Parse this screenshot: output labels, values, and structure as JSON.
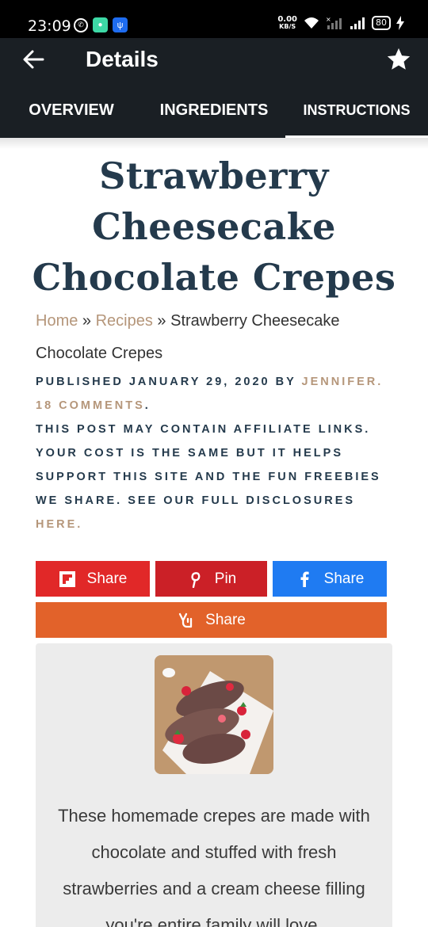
{
  "status_bar": {
    "time": "23:09",
    "speed_value": "0.00",
    "speed_unit": "KB/S",
    "battery": "80"
  },
  "app_bar": {
    "title": "Details",
    "back_icon": "arrow-left-icon",
    "favorite_icon": "star-icon"
  },
  "tabs": [
    {
      "label": "OVERVIEW"
    },
    {
      "label": "INGREDIENTS"
    },
    {
      "label": "INSTRUCTIONS",
      "active": true
    }
  ],
  "article": {
    "title": "Strawberry Cheesecake Chocolate Crepes",
    "breadcrumb": {
      "home": "Home",
      "sep1": " » ",
      "recipes": "Recipes",
      "sep2": " » ",
      "current": "Strawberry Cheesecake Chocolate Crepes"
    },
    "meta": {
      "published": "PUBLISHED JANUARY 29, 2020 BY ",
      "author": "JENNIFER",
      "sep": ". ",
      "comments": "18 COMMENTS",
      "end": ".",
      "disclosure": "THIS POST MAY CONTAIN AFFILIATE LINKS. YOUR COST IS THE SAME BUT IT HELPS SUPPORT THIS SITE AND THE FUN FREEBIES WE SHARE. SEE OUR FULL DISCLOSURES ",
      "here": "HERE",
      "here_end": "."
    }
  },
  "share": {
    "flipboard": "Share",
    "pinterest": "Pin",
    "facebook": "Share",
    "yummly": "Share",
    "colors": {
      "flipboard": "#e12828",
      "pinterest": "#cb2027",
      "facebook": "#1f7bf2",
      "yummly": "#e2622a"
    }
  },
  "card": {
    "description": "These homemade crepes are made with chocolate and stuffed with fresh strawberries and a cream cheese filling you're entire family will love."
  }
}
